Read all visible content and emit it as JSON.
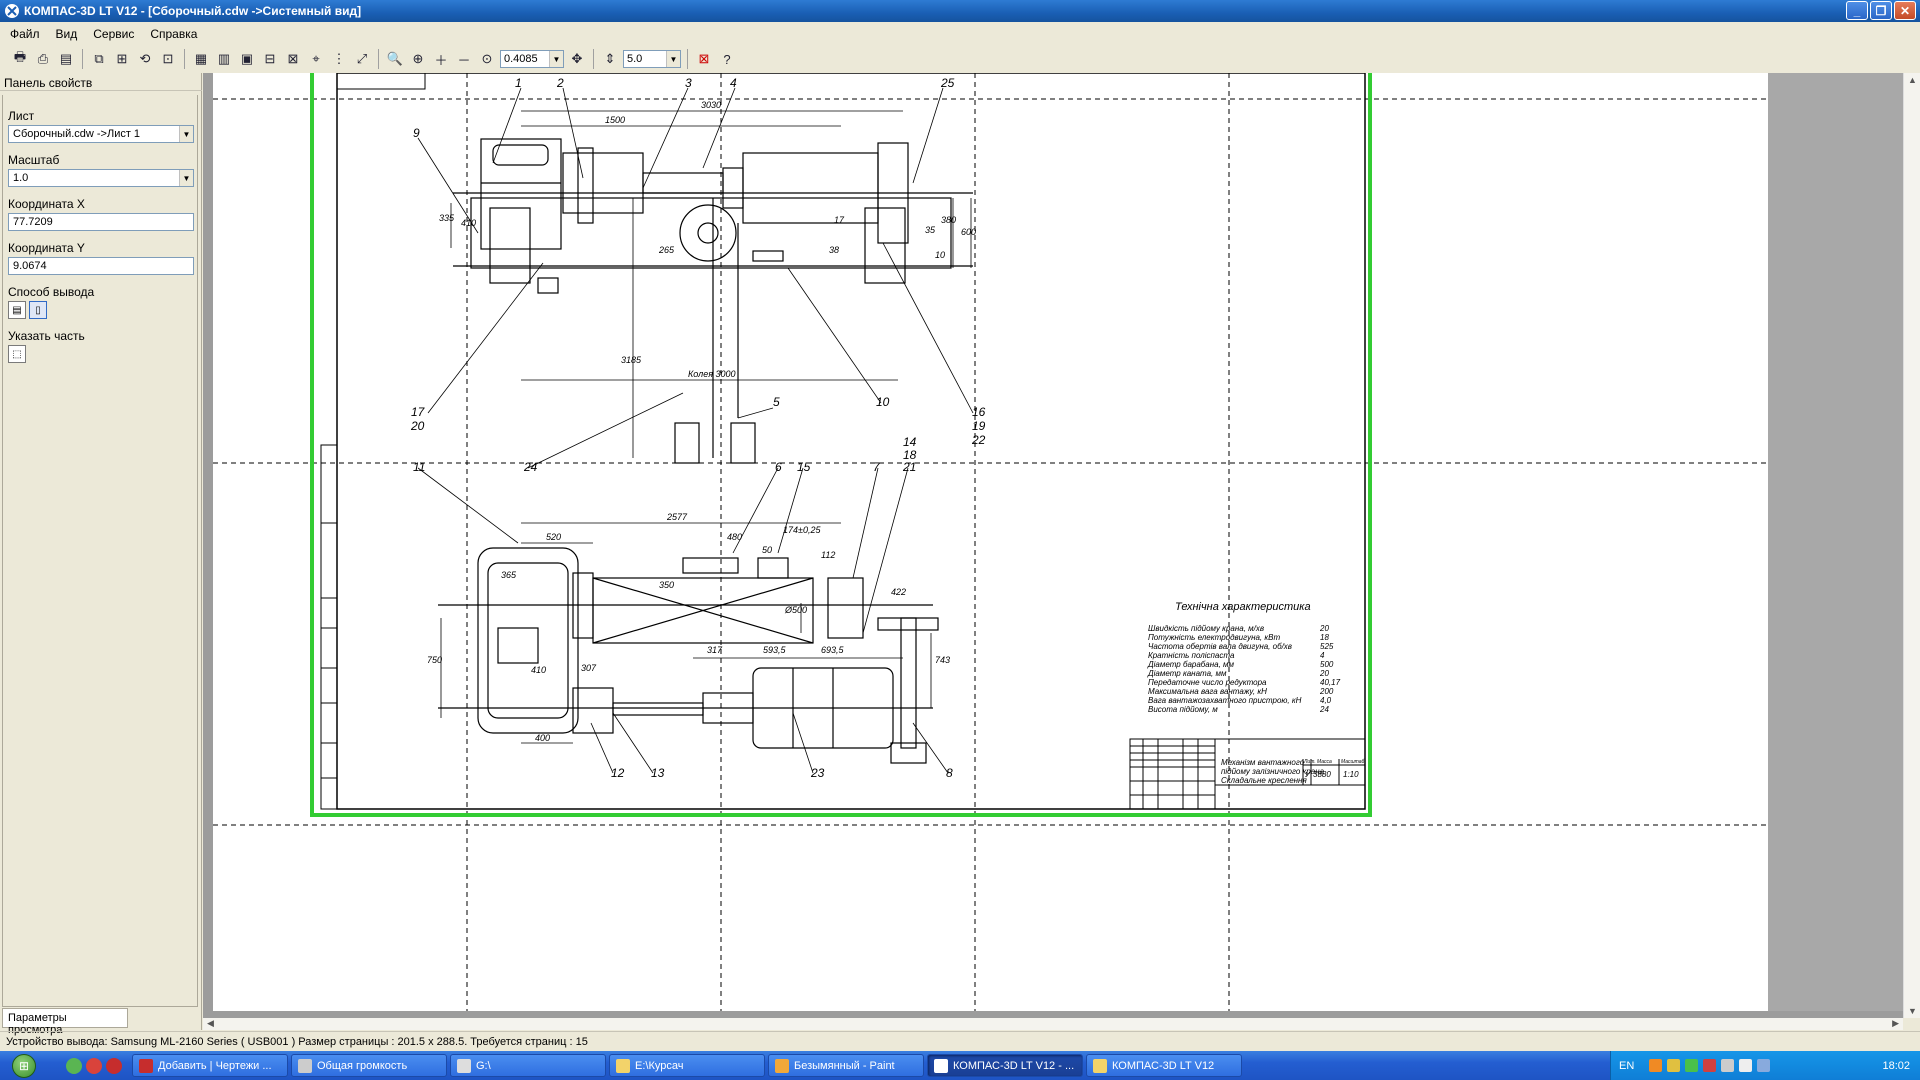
{
  "window": {
    "title": "КОМПАС-3D LT V12 - [Сборочный.cdw ->Системный вид]",
    "controls": [
      "_",
      "❐",
      "✕"
    ]
  },
  "menu": [
    "Файл",
    "Вид",
    "Сервис",
    "Справка"
  ],
  "toolbar": {
    "zoom_value": "0.4085",
    "step_value": "5.0"
  },
  "panel": {
    "title": "Панель свойств",
    "sheet_label": "Лист",
    "sheet_value": "Сборочный.cdw ->Лист 1",
    "scale_label": "Масштаб",
    "scale_value": "1.0",
    "coord_x_label": "Координата X",
    "coord_x_value": "77.7209",
    "coord_y_label": "Координата Y",
    "coord_y_value": "9.0674",
    "output_mode_label": "Способ вывода",
    "part_label": "Указать часть",
    "tab_label": "Параметры просмотра"
  },
  "drawing": {
    "dimensions": [
      "1500",
      "3030",
      "2577",
      "520",
      "480",
      "174±0,25",
      "112",
      "422",
      "410",
      "307",
      "317",
      "593,5",
      "693,5",
      "400",
      "750",
      "743",
      "365",
      "350",
      "Ø500",
      "335",
      "410",
      "380",
      "600",
      "265",
      "3185",
      "Колея 3000",
      "50",
      "35",
      "10",
      "38",
      "17"
    ],
    "callouts": [
      "1",
      "2",
      "3",
      "4",
      "25",
      "9",
      "5",
      "10",
      "17",
      "20",
      "24",
      "16",
      "19",
      "22",
      "11",
      "6",
      "15",
      "7",
      "21",
      "14",
      "18",
      "12",
      "13",
      "23",
      "8"
    ],
    "specs_title": "Технічна характеристика",
    "specs": [
      {
        "label": "Швидкість підйому крана, м/хв",
        "value": "20"
      },
      {
        "label": "Потужність електродвигуна, кВт",
        "value": "18"
      },
      {
        "label": "Частота обертів вала двигуна, об/хв",
        "value": "525"
      },
      {
        "label": "Кратність поліспаста",
        "value": "4"
      },
      {
        "label": "Діаметр барабана, мм",
        "value": "500"
      },
      {
        "label": "Діаметр каната, мм",
        "value": "20"
      },
      {
        "label": "Передаточне число редуктора",
        "value": "40,17"
      },
      {
        "label": "Максимальна вага вантажу, кН",
        "value": "200"
      },
      {
        "label": "Вага вантажозахватного пристрою, кН",
        "value": "4,0"
      },
      {
        "label": "Висота підйому, м",
        "value": "24"
      }
    ],
    "title_block": {
      "name_line1": "Механізм вантажного",
      "name_line2": "підйому залізничного крана",
      "name_line3": "Складальне креслення",
      "mass": "3880",
      "scale": "1:10",
      "mass_hdr": "Масса",
      "scale_hdr": "Масштаб",
      "letter_hdr": "Лит.",
      "letter": "У"
    }
  },
  "statusbar": {
    "text": "Устройство вывода: Samsung ML-2160 Series ( USB001 )  Размер страницы : 201.5 x 288.5.  Требуется страниц : 15"
  },
  "taskbar": {
    "items": [
      "Добавить | Чертежи ...",
      "Общая громкость",
      "G:\\",
      "E:\\Курсач",
      "Безымянный - Paint",
      "КОМПАС-3D LT V12 - ...",
      "КОМПАС-3D LT V12"
    ],
    "lang": "EN",
    "clock": "18:02"
  },
  "colors": {
    "accent": "#1a5fb4",
    "sheet_frame": "#33cc33",
    "taskbar": "#245ed1"
  }
}
